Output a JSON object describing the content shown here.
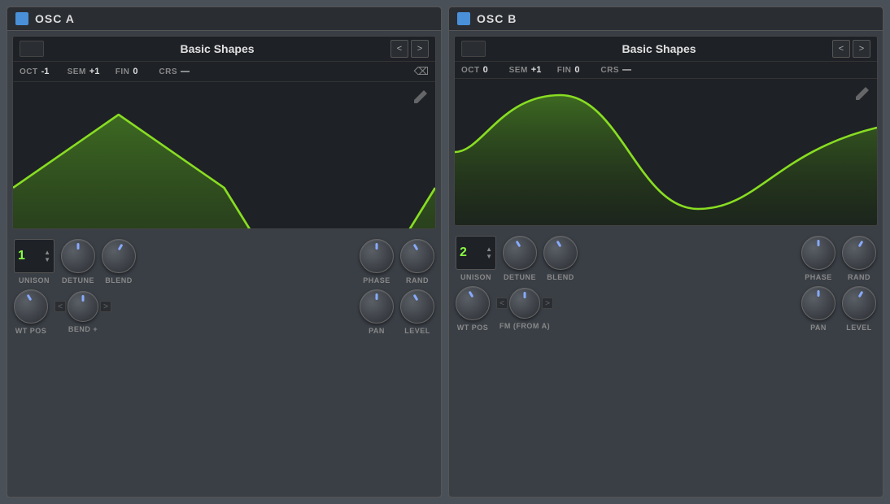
{
  "oscA": {
    "title": "OSC A",
    "waveform_name": "Basic Shapes",
    "oct": "-1",
    "sem": "+1",
    "fin": "0",
    "crs": "—",
    "unison": "1",
    "controls_row1": [
      "UNISON",
      "DETUNE",
      "BLEND",
      "PHASE",
      "RAND"
    ],
    "controls_row2_labels": [
      "WT POS",
      "BEND +",
      "PAN",
      "LEVEL"
    ],
    "waveform_type": "triangle"
  },
  "oscB": {
    "title": "OSC B",
    "waveform_name": "Basic Shapes",
    "oct": "0",
    "sem": "+1",
    "fin": "0",
    "crs": "—",
    "unison": "2",
    "controls_row1": [
      "UNISON",
      "DETUNE",
      "BLEND",
      "PHASE",
      "RAND"
    ],
    "controls_row2_labels": [
      "WT POS",
      "FM (FROM A)",
      "PAN",
      "LEVEL"
    ],
    "waveform_type": "sine"
  },
  "nav": {
    "prev": "<",
    "next": ">"
  }
}
